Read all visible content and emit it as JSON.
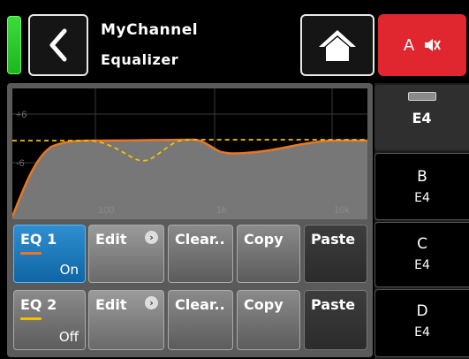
{
  "header": {
    "title": "MyChannel",
    "subtitle": "Equalizer",
    "mute_label": "A"
  },
  "graph": {
    "y_labels": [
      "+6",
      "-6"
    ],
    "x_labels": [
      "100",
      "1k",
      "10k"
    ]
  },
  "eq_rows": [
    {
      "eq_label": "EQ 1",
      "state": "On",
      "active": true,
      "color": "#e87722",
      "edit": "Edit",
      "clear": "Clear..",
      "copy": "Copy",
      "paste": "Paste"
    },
    {
      "eq_label": "EQ 2",
      "state": "Off",
      "active": false,
      "color": "#f2c200",
      "edit": "Edit",
      "clear": "Clear..",
      "copy": "Copy",
      "paste": "Paste"
    }
  ],
  "channels": [
    {
      "name": "",
      "sub": "E4",
      "selected": true
    },
    {
      "name": "B",
      "sub": "E4",
      "selected": false
    },
    {
      "name": "C",
      "sub": "E4",
      "selected": false
    },
    {
      "name": "D",
      "sub": "E4",
      "selected": false
    }
  ],
  "colors": {
    "accent_blue": "#1a73b8",
    "mute_red": "#e0262e",
    "eq1_curve": "#e87722",
    "eq2_curve": "#f2c200",
    "level_green": "#2ecc2e"
  }
}
